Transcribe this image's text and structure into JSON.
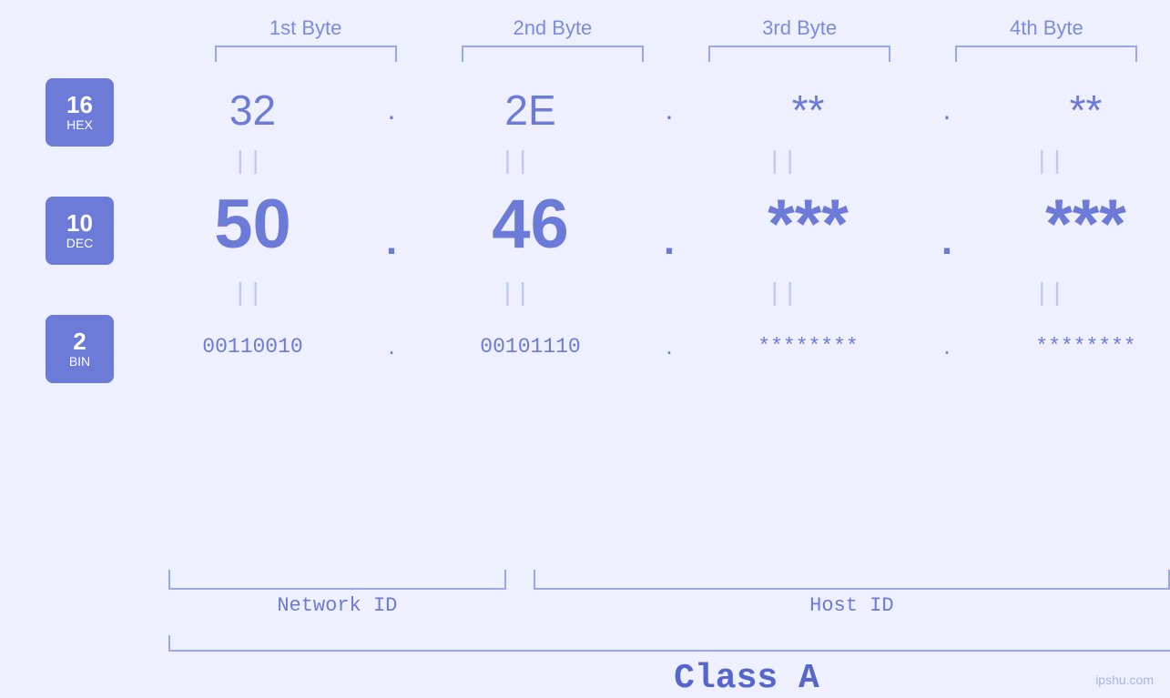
{
  "header": {
    "bytes": [
      {
        "label": "1st Byte"
      },
      {
        "label": "2nd Byte"
      },
      {
        "label": "3rd Byte"
      },
      {
        "label": "4th Byte"
      }
    ]
  },
  "badges": [
    {
      "num": "16",
      "label": "HEX"
    },
    {
      "num": "10",
      "label": "DEC"
    },
    {
      "num": "2",
      "label": "BIN"
    }
  ],
  "rows": {
    "hex": {
      "values": [
        "32",
        "2E",
        "**",
        "**"
      ],
      "dots": [
        ".",
        ".",
        "."
      ]
    },
    "dec": {
      "values": [
        "50",
        "46",
        "***",
        "***"
      ],
      "dots": [
        ".",
        ".",
        "."
      ]
    },
    "bin": {
      "values": [
        "00110010",
        "00101110",
        "********",
        "********"
      ],
      "dots": [
        ".",
        ".",
        "."
      ]
    }
  },
  "equals": "||",
  "labels": {
    "network_id": "Network ID",
    "host_id": "Host ID",
    "class": "Class A"
  },
  "watermark": "ipshu.com"
}
